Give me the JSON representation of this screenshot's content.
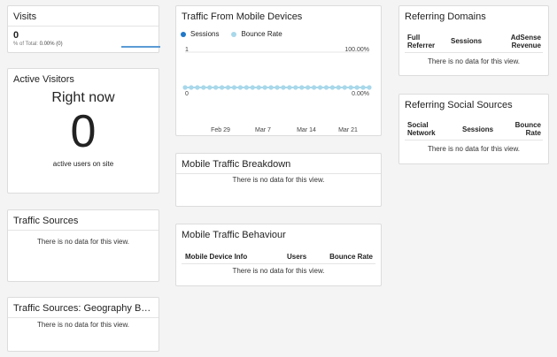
{
  "visits": {
    "title": "Visits",
    "value": "0",
    "total_prefix": "% of Total:",
    "total_value": "0.00% (0)"
  },
  "active_visitors": {
    "title": "Active Visitors",
    "heading": "Right now",
    "count": "0",
    "caption": "active users on site"
  },
  "traffic_sources": {
    "title": "Traffic Sources",
    "message": "There is no data for this view."
  },
  "geo": {
    "title": "Traffic Sources: Geography Breakd...",
    "message": "There is no data for this view."
  },
  "mobile_traffic": {
    "title": "Traffic From Mobile Devices",
    "legend": [
      {
        "name": "Sessions",
        "color": "#1f78c8"
      },
      {
        "name": "Bounce Rate",
        "color": "#a8d8ea"
      }
    ]
  },
  "chart_data": {
    "type": "line",
    "categories_ticks": [
      "Feb 29",
      "Mar 7",
      "Mar 14",
      "Mar 21"
    ],
    "left_axis_ticks": [
      "1",
      "0"
    ],
    "right_axis_ticks": [
      "100.00%",
      "0.00%"
    ],
    "series": [
      {
        "name": "Sessions",
        "color": "#1f78c8",
        "values": [
          0,
          0,
          0,
          0,
          0,
          0,
          0,
          0,
          0,
          0,
          0,
          0,
          0,
          0,
          0,
          0,
          0,
          0,
          0,
          0,
          0,
          0,
          0,
          0,
          0,
          0,
          0,
          0,
          0,
          0,
          0
        ]
      },
      {
        "name": "Bounce Rate",
        "color": "#a8d8ea",
        "values": [
          0,
          0,
          0,
          0,
          0,
          0,
          0,
          0,
          0,
          0,
          0,
          0,
          0,
          0,
          0,
          0,
          0,
          0,
          0,
          0,
          0,
          0,
          0,
          0,
          0,
          0,
          0,
          0,
          0,
          0,
          0
        ]
      }
    ],
    "ylim_left": [
      0,
      1
    ],
    "ylim_right": [
      0,
      100
    ]
  },
  "mobile_breakdown": {
    "title": "Mobile Traffic Breakdown",
    "message": "There is no data for this view."
  },
  "mobile_behaviour": {
    "title": "Mobile Traffic Behaviour",
    "columns": [
      "Mobile Device Info",
      "Users",
      "Bounce Rate"
    ],
    "message": "There is no data for this view."
  },
  "referring_domains": {
    "title": "Referring Domains",
    "columns": [
      "Full\nReferrer",
      "Sessions",
      "AdSense\nRevenue"
    ],
    "message": "There is no data for this view."
  },
  "social_sources": {
    "title": "Referring Social Sources",
    "columns": [
      "Social\nNetwork",
      "Sessions",
      "Bounce\nRate"
    ],
    "message": "There is no data for this view."
  }
}
